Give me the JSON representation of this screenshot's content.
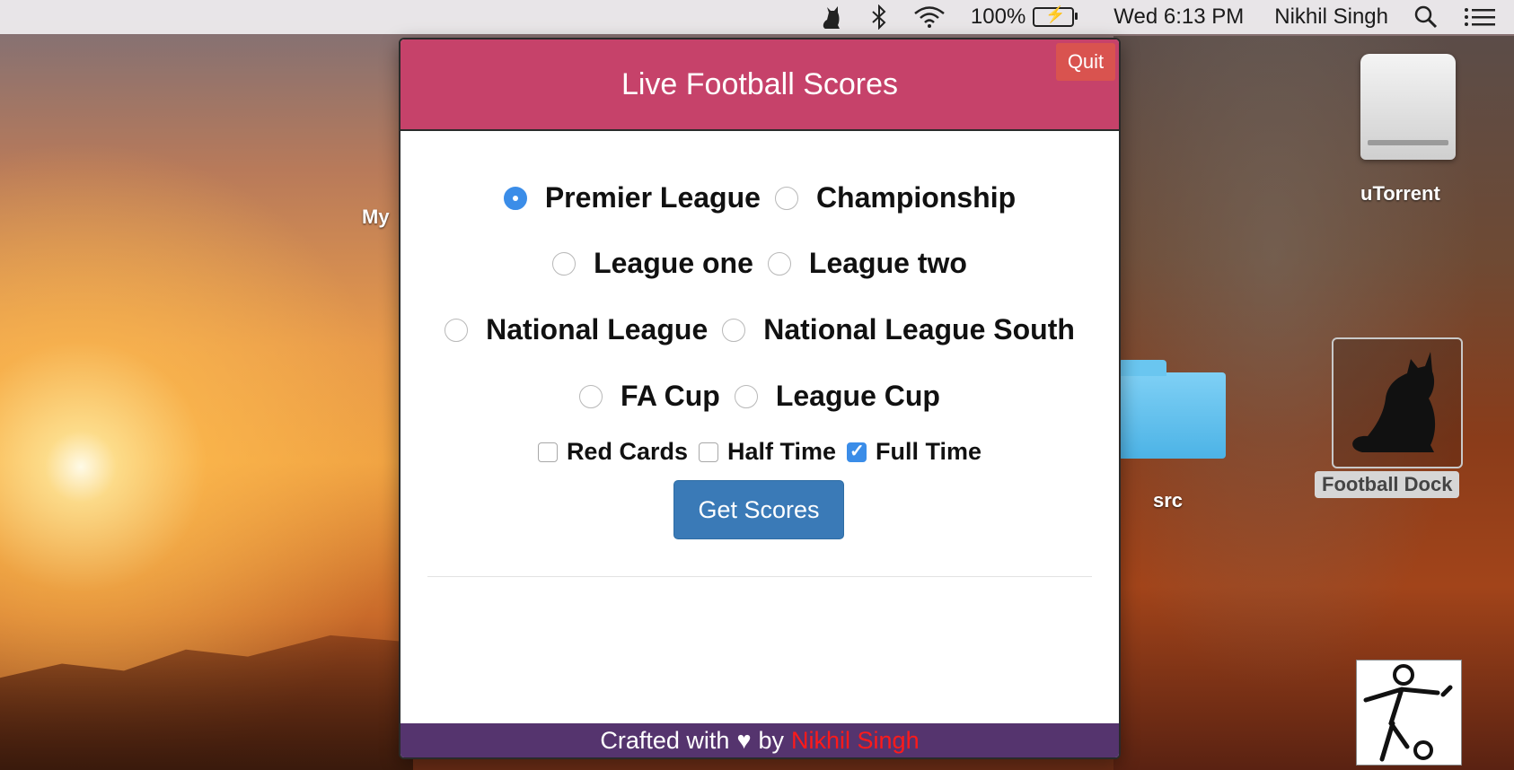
{
  "menubar": {
    "battery_percent": "100%",
    "clock": "Wed 6:13 PM",
    "user": "Nikhil Singh",
    "icons": [
      "cat-icon",
      "bluetooth-icon",
      "wifi-icon",
      "battery-icon",
      "spotlight-search-icon",
      "notification-list-icon"
    ]
  },
  "desktop": {
    "partial_label": "My",
    "drive_label": "uTorrent",
    "folder_label": "src",
    "dock_label": "Football Dock"
  },
  "app": {
    "title": "Live Football Scores",
    "quit_label": "Quit",
    "leagues": [
      {
        "label": "Premier League",
        "selected": true
      },
      {
        "label": "Championship",
        "selected": false
      },
      {
        "label": "League one",
        "selected": false
      },
      {
        "label": "League two",
        "selected": false
      },
      {
        "label": "National League",
        "selected": false
      },
      {
        "label": "National League South",
        "selected": false
      },
      {
        "label": "FA Cup",
        "selected": false
      },
      {
        "label": "League Cup",
        "selected": false
      }
    ],
    "options": [
      {
        "label": "Red Cards",
        "checked": false
      },
      {
        "label": "Half Time",
        "checked": false
      },
      {
        "label": "Full Time",
        "checked": true
      }
    ],
    "button_label": "Get Scores",
    "footer": {
      "prefix": "Crafted with",
      "heart": "♥",
      "by": "by",
      "author": "Nikhil Singh"
    }
  },
  "colors": {
    "header": "#c6426a",
    "footer": "#55346e",
    "button": "#3a7ab7",
    "quit": "#d9534f",
    "accent": "#3b8de8"
  }
}
